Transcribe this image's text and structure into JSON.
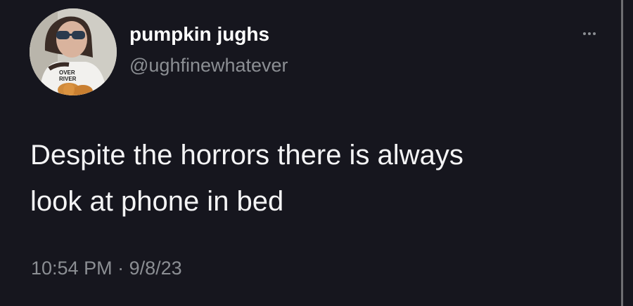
{
  "tweet": {
    "author": {
      "display_name": "pumpkin jughs",
      "handle": "@ughfinewhatever",
      "avatar_shirt_text": [
        "OVER",
        "RIVER"
      ]
    },
    "more_icon": "more-horizontal-icon",
    "text_lines": [
      "Despite the horrors there is always",
      "look at phone in bed"
    ],
    "time": "10:54 PM",
    "separator": "·",
    "date": "9/8/23"
  },
  "colors": {
    "background": "#16161e",
    "text": "#f4f4f5",
    "secondary_text": "#8b8e93"
  }
}
